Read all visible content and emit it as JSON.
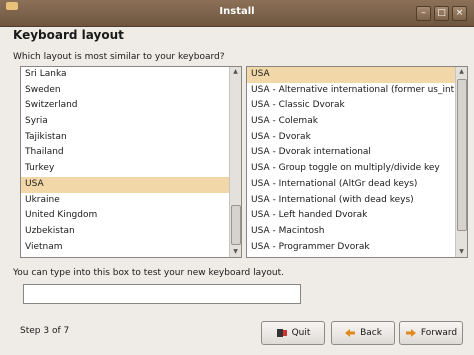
{
  "window": {
    "title": "Install"
  },
  "page": {
    "heading": "Keyboard layout",
    "question": "Which layout is most similar to your keyboard?",
    "test_label": "You can type into this box to test your new keyboard layout.",
    "test_value": "",
    "step": "Step 3 of 7"
  },
  "countries": [
    {
      "label": "Sri Lanka"
    },
    {
      "label": "Sweden"
    },
    {
      "label": "Switzerland"
    },
    {
      "label": "Syria"
    },
    {
      "label": "Tajikistan"
    },
    {
      "label": "Thailand"
    },
    {
      "label": "Turkey"
    },
    {
      "label": "USA",
      "selected": true
    },
    {
      "label": "Ukraine"
    },
    {
      "label": "United Kingdom"
    },
    {
      "label": "Uzbekistan"
    },
    {
      "label": "Vietnam"
    }
  ],
  "layouts": [
    {
      "label": "USA",
      "selected": true
    },
    {
      "label": "USA - Alternative international (former us_intl)"
    },
    {
      "label": "USA - Classic Dvorak"
    },
    {
      "label": "USA - Colemak"
    },
    {
      "label": "USA - Dvorak"
    },
    {
      "label": "USA - Dvorak international"
    },
    {
      "label": "USA - Group toggle on multiply/divide key"
    },
    {
      "label": "USA - International (AltGr dead keys)"
    },
    {
      "label": "USA - International (with dead keys)"
    },
    {
      "label": "USA - Left handed Dvorak"
    },
    {
      "label": "USA - Macintosh"
    },
    {
      "label": "USA - Programmer Dvorak"
    }
  ],
  "buttons": {
    "quit": "Quit",
    "back": "Back",
    "forward": "Forward"
  },
  "colors": {
    "titlebar": "#7c6249",
    "selection": "#f2d8a8",
    "background": "#efebe7"
  }
}
